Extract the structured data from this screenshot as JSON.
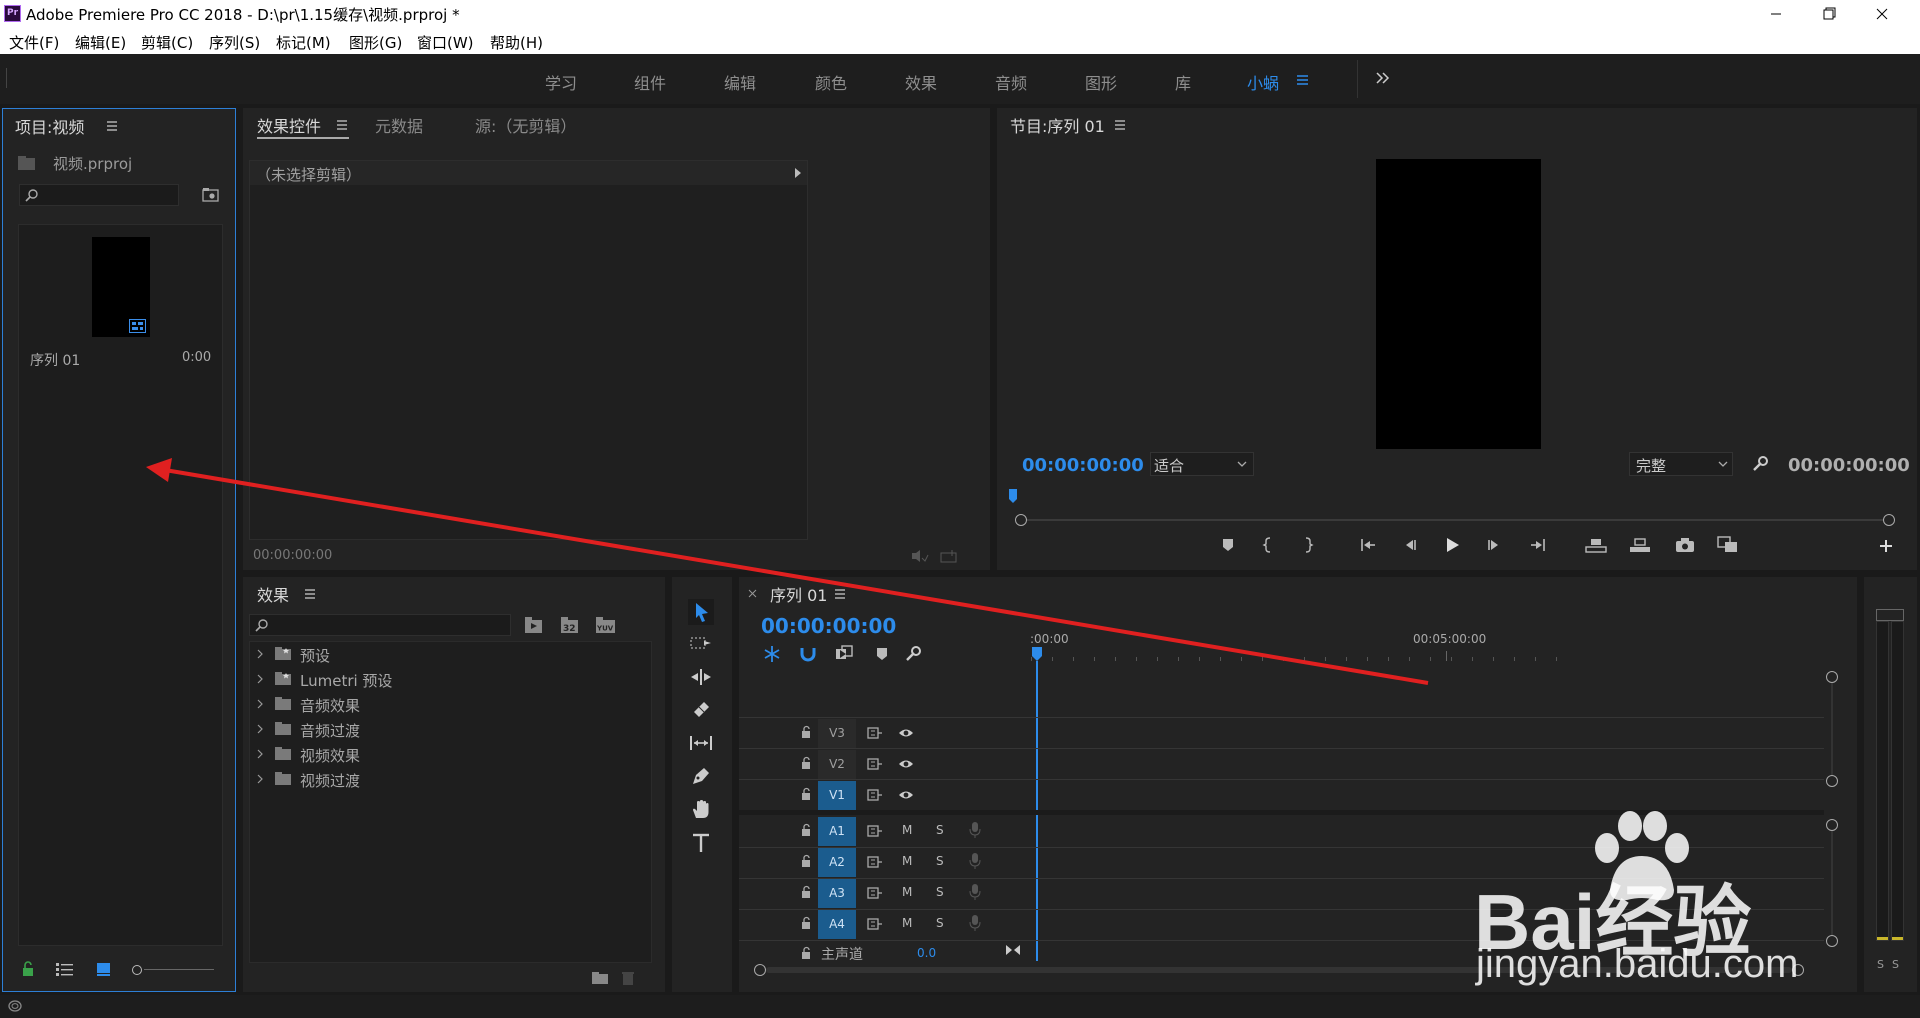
{
  "app": {
    "title": "Adobe Premiere Pro CC 2018 - D:\\pr\\1.15缓存\\视频.prproj *",
    "logo_text": "Pr",
    "accent": "#2d8ceb"
  },
  "menu": [
    "文件(F)",
    "编辑(E)",
    "剪辑(C)",
    "序列(S)",
    "标记(M)",
    "图形(G)",
    "窗口(W)",
    "帮助(H)"
  ],
  "workspaces": {
    "tabs": [
      "学习",
      "组件",
      "编辑",
      "颜色",
      "效果",
      "音频",
      "图形",
      "库",
      "小蜗"
    ],
    "active": "小蜗"
  },
  "project": {
    "title": "项目:视频",
    "file": "视频.prproj",
    "search_placeholder": "",
    "item": {
      "name": "序列 01",
      "duration": "0:00"
    }
  },
  "effect_controls": {
    "tabs": [
      "效果控件",
      "元数据",
      "源:（无剪辑）"
    ],
    "no_clip": "（未选择剪辑）",
    "timecode": "00:00:00:00"
  },
  "program": {
    "title": "节目:序列 01",
    "timecode": "00:00:00:00",
    "fit": "适合",
    "quality": "完整",
    "duration": "00:00:00:00"
  },
  "effects": {
    "title": "效果",
    "search_placeholder": "",
    "items": [
      "预设",
      "Lumetri 预设",
      "音频效果",
      "音频过渡",
      "视频效果",
      "视频过渡"
    ]
  },
  "timeline": {
    "tab": "序列 01",
    "timecode": "00:00:00:00",
    "ruler": [
      ":00:00",
      "00:05:00:00"
    ],
    "video_tracks": [
      "V3",
      "V2",
      "V1"
    ],
    "audio_tracks": [
      "A1",
      "A2",
      "A3",
      "A4"
    ],
    "master_label": "主声道",
    "master_value": "0.0",
    "mute": "M",
    "solo": "S"
  },
  "meters": {
    "labels": [
      "S",
      "S"
    ]
  },
  "watermark": {
    "brand": "Bai经验",
    "url": "jingyan.baidu.com"
  }
}
